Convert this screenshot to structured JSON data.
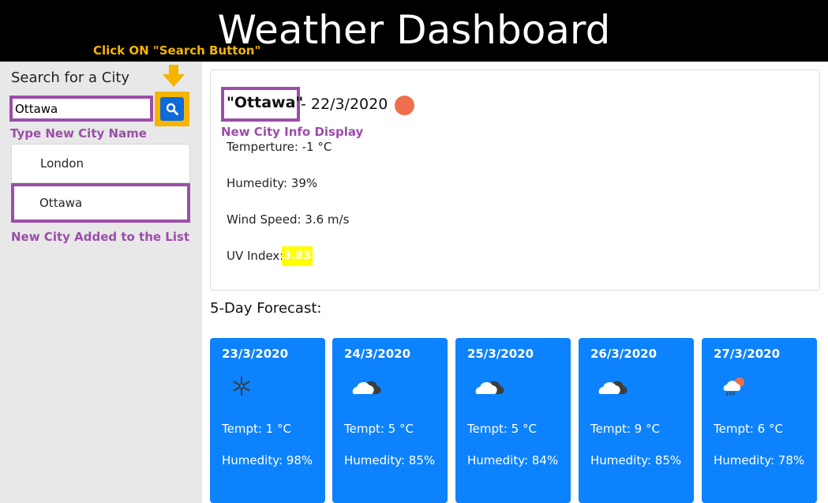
{
  "header": {
    "title": "Weather Dashboard"
  },
  "annotations": {
    "click_search": "Click ON \"Search Button\"",
    "type_city": "Type New City Name",
    "city_added": "New City Added to the List",
    "info_display": "New City Info Display"
  },
  "sidebar": {
    "title": "Search for a City",
    "search_value": "Ottawa",
    "cities": [
      "London",
      "Ottawa"
    ]
  },
  "current": {
    "city": "\"Ottawa\"",
    "date": "- 22/3/2020",
    "temperature": "Temperture: -1 °C",
    "humidity": "Humedity: 39%",
    "wind": "Wind Speed: 3.6 m/s",
    "uv_label": "UV Index:",
    "uv_value": "3.83",
    "icon": "sun-icon",
    "icon_color": "#ee6e4d",
    "uv_color": "#ffff00"
  },
  "forecast": {
    "title": "5-Day Forecast:",
    "card_color": "#0d82fd",
    "days": [
      {
        "date": "23/3/2020",
        "icon": "snow-icon",
        "temp": "Tempt: 1 °C",
        "humidity": "Humedity: 98%"
      },
      {
        "date": "24/3/2020",
        "icon": "cloud-icon",
        "temp": "Tempt: 5 °C",
        "humidity": "Humedity: 85%"
      },
      {
        "date": "25/3/2020",
        "icon": "cloud-icon",
        "temp": "Tempt: 5 °C",
        "humidity": "Humedity: 84%"
      },
      {
        "date": "26/3/2020",
        "icon": "cloud-icon",
        "temp": "Tempt: 9 °C",
        "humidity": "Humedity: 85%"
      },
      {
        "date": "27/3/2020",
        "icon": "rain-sun-icon",
        "temp": "Tempt: 6 °C",
        "humidity": "Humedity: 78%"
      }
    ]
  }
}
